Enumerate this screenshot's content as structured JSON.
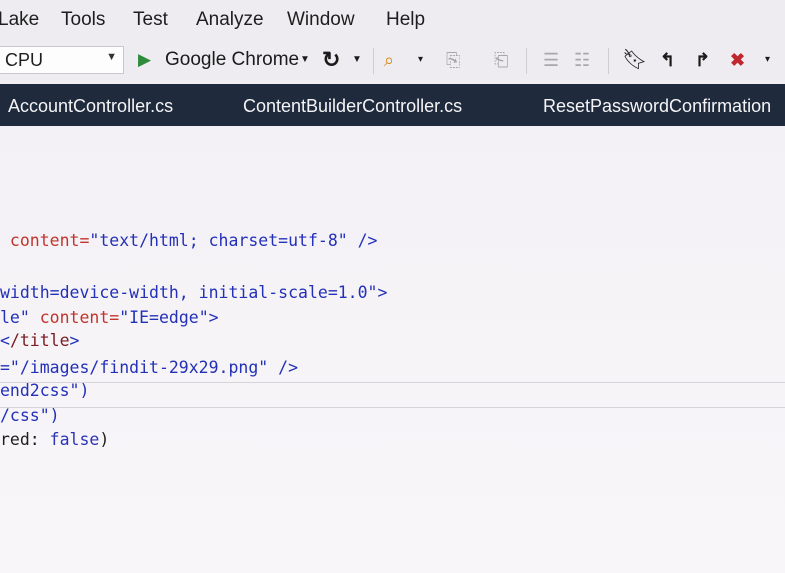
{
  "menubar": {
    "items": [
      "Lake",
      "Tools",
      "Test",
      "Analyze",
      "Window",
      "Help"
    ]
  },
  "toolbar": {
    "platform_value": "CPU",
    "run_target_label": "Google Chrome",
    "accent_play": "#2e8b3a"
  },
  "tabs": [
    "AccountController.cs",
    "ContentBuilderController.cs",
    "ResetPasswordConfirmation"
  ],
  "code": {
    "line1": {
      "attr": " content=",
      "str": "\"text/html; charset=utf-8\"",
      "end": " />"
    },
    "line2": {
      "str": "width=device-width, initial-scale=1.0\"",
      "end": ">"
    },
    "line3": {
      "str1": "le\"",
      "attr": " content=",
      "str2": "\"IE=edge\"",
      "end": ">"
    },
    "line4": {
      "tag": "/title",
      "end": ">"
    },
    "line5": {
      "str": "=\"/images/findit-29x29.png\"",
      "end": " />"
    },
    "line6": {
      "str": "end2css\")"
    },
    "line7": {
      "str": "/css\")"
    },
    "line8": {
      "plain": "red: ",
      "kw": "false",
      "end": ")"
    }
  }
}
